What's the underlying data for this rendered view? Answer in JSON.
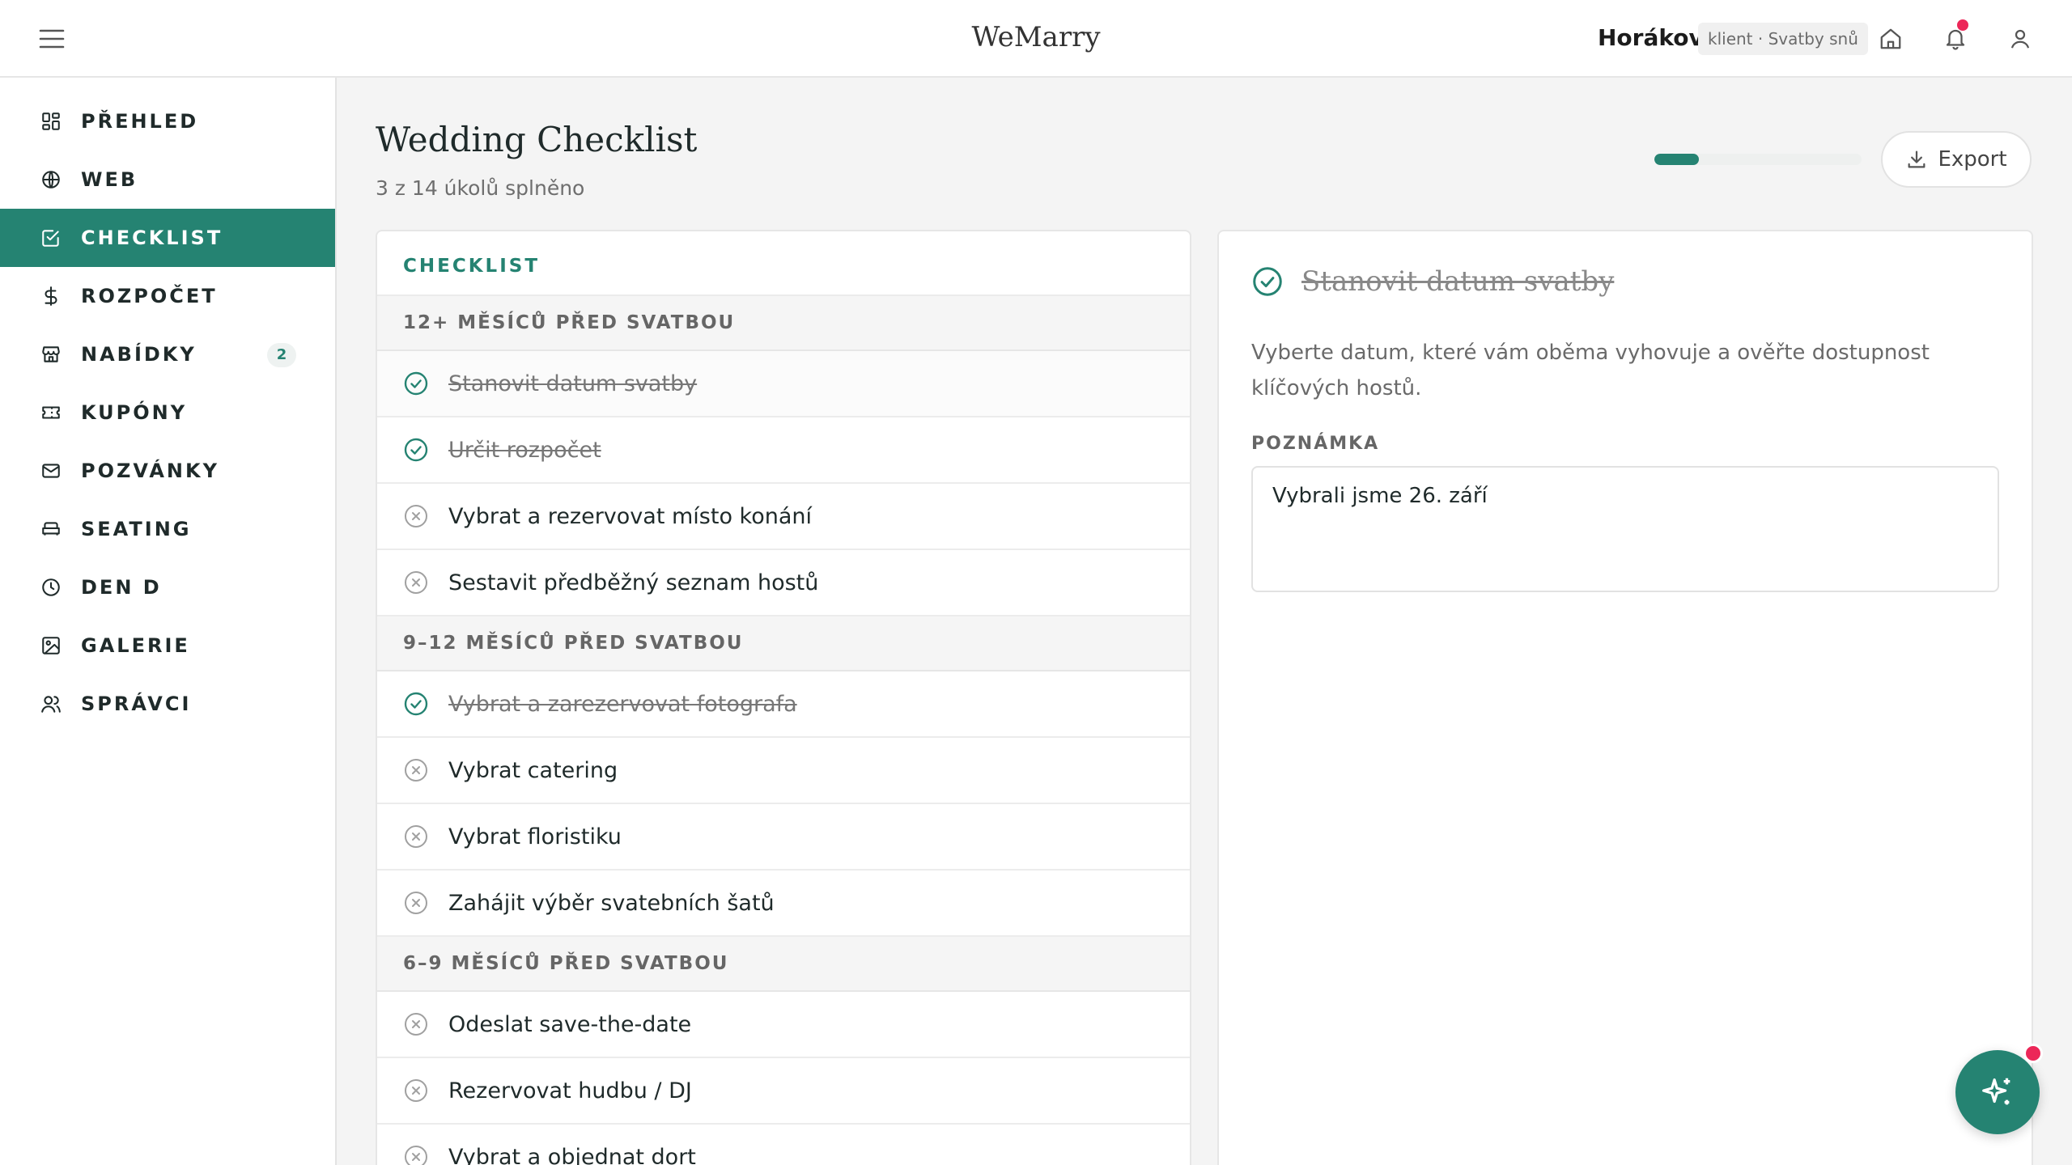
{
  "app": {
    "brand": "WeMarry"
  },
  "header": {
    "user_name": "Horákovi",
    "user_chip": "klient · Svatby snů"
  },
  "sidebar": {
    "items": [
      {
        "label": "PŘEHLED",
        "icon": "dashboard-icon"
      },
      {
        "label": "WEB",
        "icon": "globe-icon"
      },
      {
        "label": "CHECKLIST",
        "icon": "checklist-icon",
        "active": true
      },
      {
        "label": "ROZPOČET",
        "icon": "dollar-icon"
      },
      {
        "label": "NABÍDKY",
        "icon": "store-icon",
        "badge": "2"
      },
      {
        "label": "KUPÓNY",
        "icon": "ticket-icon"
      },
      {
        "label": "POZVÁNKY",
        "icon": "mail-icon"
      },
      {
        "label": "SEATING",
        "icon": "sofa-icon"
      },
      {
        "label": "DEN D",
        "icon": "clock-icon"
      },
      {
        "label": "GALERIE",
        "icon": "image-icon"
      },
      {
        "label": "SPRÁVCI",
        "icon": "users-icon"
      }
    ]
  },
  "page": {
    "title": "Wedding Checklist",
    "subtitle": "3 z 14 úkolů splněno",
    "progress": 0.2143,
    "export_label": "Export"
  },
  "checklist": {
    "heading": "CHECKLIST",
    "groups": [
      {
        "title": "12+ MĚSÍCŮ PŘED SVATBOU",
        "tasks": [
          {
            "label": "Stanovit datum svatby",
            "done": true
          },
          {
            "label": "Určit rozpočet",
            "done": true
          },
          {
            "label": "Vybrat a rezervovat místo konání",
            "done": false
          },
          {
            "label": "Sestavit předběžný seznam hostů",
            "done": false
          }
        ]
      },
      {
        "title": "9–12 MĚSÍCŮ PŘED SVATBOU",
        "tasks": [
          {
            "label": "Vybrat a zarezervovat fotografa",
            "done": true
          },
          {
            "label": "Vybrat catering",
            "done": false
          },
          {
            "label": "Vybrat floristiku",
            "done": false
          },
          {
            "label": "Zahájit výběr svatebních šatů",
            "done": false
          }
        ]
      },
      {
        "title": "6–9 MĚSÍCŮ PŘED SVATBOU",
        "tasks": [
          {
            "label": "Odeslat save-the-date",
            "done": false
          },
          {
            "label": "Rezervovat hudbu / DJ",
            "done": false
          },
          {
            "label": "Vybrat a objednat dort",
            "done": false
          }
        ]
      }
    ]
  },
  "detail": {
    "title": "Stanovit datum svatby",
    "description": "Vyberte datum, které vám oběma vyhovuje a ověřte dostupnost klíčových hostů.",
    "note_label": "POZNÁMKA",
    "note_value": "Vybrali jsme 26. září"
  },
  "colors": {
    "accent": "#258372",
    "notification": "#ec2758",
    "check_done": "#258372",
    "check_todo": "#9a9a9a"
  }
}
